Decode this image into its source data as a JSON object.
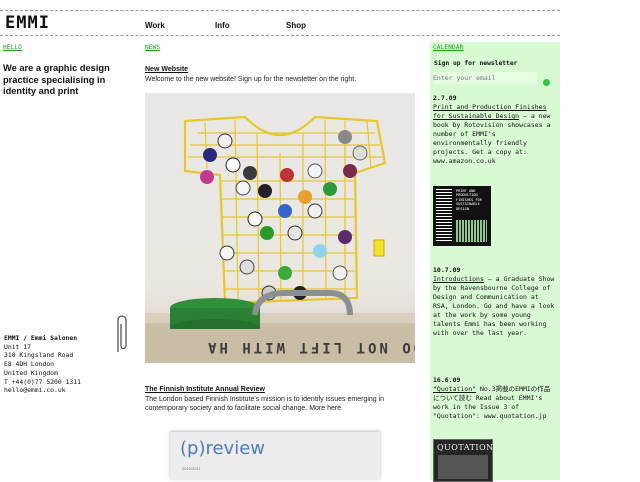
{
  "header": {
    "logo": "EMMI",
    "nav": [
      {
        "label": "Work"
      },
      {
        "label": "Info"
      },
      {
        "label": "Shop"
      }
    ]
  },
  "left": {
    "section_label": "HELLO",
    "tagline": "We are a graphic design practice specialising in identity and print",
    "address_lines": [
      "EMMI / Emmi Salonen",
      "Unit 17",
      "310 Kingsland Road",
      "E8 4DH London",
      "United Kingdom",
      "T +44(0)77 5200 1311",
      "hello@emmi.co.uk"
    ]
  },
  "main": {
    "section_label": "NEWS",
    "posts": [
      {
        "title": "New Website",
        "body": "Welcome to the new website! Sign up for the newsletter on the right."
      },
      {
        "title": "The Finnish Institute Annual Review",
        "body": "The London based Finnish Institute's mission is to identify issues emerging in contemporary society and to facilitate social change. More here"
      }
    ],
    "hero_sign": "DO NOT LIFT WITH HA",
    "preview_title": "(p)review",
    "preview_sub": "2010/2011"
  },
  "sidebar": {
    "section_label": "CALENDAR",
    "newsletter_label": "Sign up for newsletter",
    "email_placeholder": "Enter your email",
    "items": [
      {
        "date": "2.7.09",
        "link": "Print and Production Finishes for Sustainable Design",
        "text": " – a new book by Rotovision showcases a number of EMMI's environmentally friendly projects. Get a copy at: www.amazon.co.uk"
      },
      {
        "date": "10.7.09",
        "link": "Introductions",
        "text": " – a Graduate Show by the Ravensbourne College of Design and Communication at RSA, London. Go and have a look at the work by some young talents Emmi has been working with over the last year."
      },
      {
        "date": "16.6.09",
        "link": "\"Quotation\"",
        "text": " No.3掲載のEMMIの作品について読む Read about EMMI's work in the Issue 3 of \"Quotation\": www.quotation.jp"
      }
    ],
    "book_cover_text": "PRINT AND PRODUCTION FINISHES FOR SUSTAINABLE DESIGN",
    "quotation_cover": "QUOTATION"
  },
  "colors": {
    "accent_green": "#1a9a1a",
    "sidebar_bg": "#d9fbd4",
    "crate_yellow": "#f2d43a"
  }
}
